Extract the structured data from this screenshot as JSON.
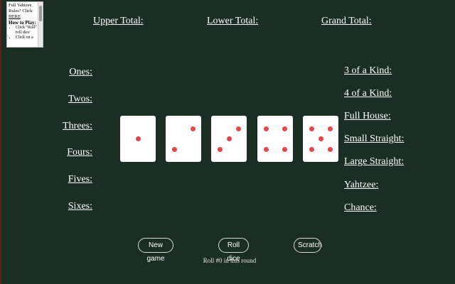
{
  "rules_panel": {
    "line1": "Full Yahtzee",
    "line2": "Rules? Click",
    "link": "HERE",
    "how_to_play": "How to Play:",
    "items": [
      "Click \"Roll\" to roll dice",
      "Click on a"
    ]
  },
  "totals": {
    "upper": "Upper Total:",
    "lower": "Lower Total:",
    "grand": "Grand Total:"
  },
  "upper_section": [
    "Ones:",
    "Twos:",
    "Threes:",
    "Fours:",
    "Fives:",
    "Sixes:"
  ],
  "lower_section": [
    "3 of a Kind:",
    "4 of a Kind:",
    "Full House:",
    "Small Straight:",
    "Large Straight:",
    "Yahtzee:",
    "Chance:"
  ],
  "dice": [
    1,
    2,
    3,
    4,
    5
  ],
  "colors": {
    "background": "#1a2e23",
    "pip": "#e2474a",
    "die": "#ffffff"
  },
  "buttons": {
    "new_game": "New game",
    "roll": "Roll dice",
    "scratch": "Scratch"
  },
  "status": "Roll #0 in this round"
}
